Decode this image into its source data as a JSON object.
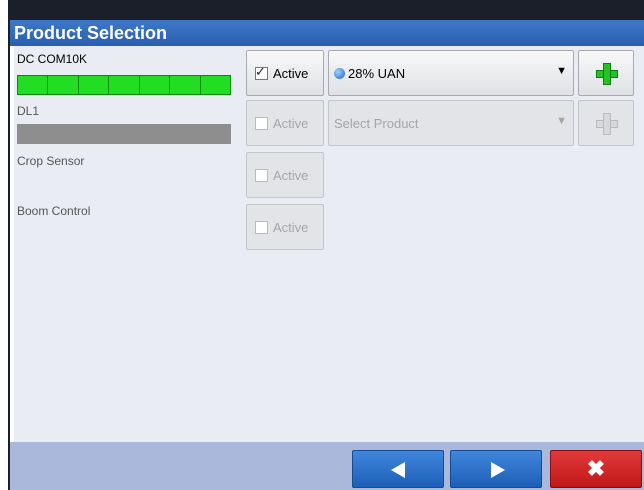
{
  "window": {
    "title": "Product Selection"
  },
  "rows": [
    {
      "name": "DC COM10K",
      "active_label": "Active",
      "checked": true,
      "product": "28% UAN",
      "bar": "green"
    },
    {
      "name": "DL1",
      "active_label": "Active",
      "checked": false,
      "product": "Select Product",
      "bar": "gray"
    },
    {
      "name": "Crop Sensor",
      "active_label": "Active",
      "checked": false
    },
    {
      "name": "Boom Control",
      "active_label": "Active",
      "checked": false
    }
  ],
  "icons": {
    "product": "globe-icon",
    "add": "plus-icon",
    "dropdown": "caret-down-icon",
    "back": "arrow-left-icon",
    "next": "arrow-right-icon",
    "cancel": "close-icon"
  },
  "symbols": {
    "caret": "▼",
    "check": "✓",
    "close": "✖"
  },
  "colors": {
    "title_bar": "#2f67b8",
    "status_bar_ok": "#22dd22",
    "status_bar_off": "#8e8e8e",
    "add_icon": "#22c322",
    "nav_button": "#2d72c8",
    "cancel_button": "#d62424"
  }
}
